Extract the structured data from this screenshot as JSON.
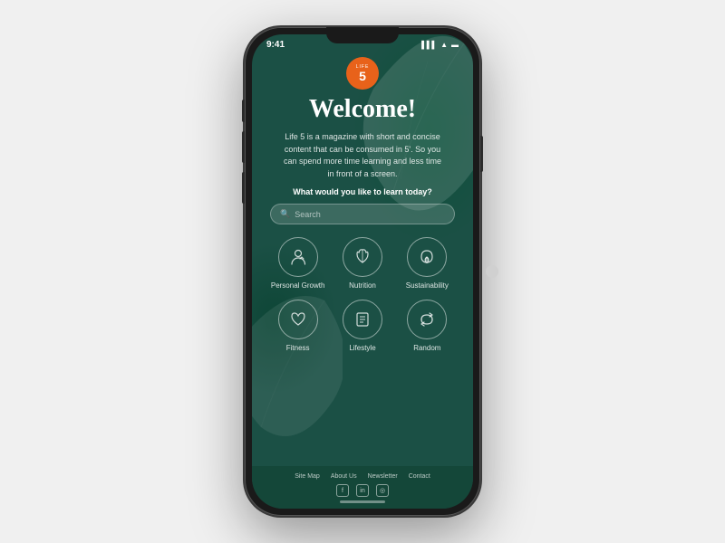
{
  "app": {
    "name": "Life 5",
    "logo_number": "5",
    "logo_sub": "LIFE"
  },
  "status_bar": {
    "time": "9:41",
    "signal": "▌▌▌",
    "wifi": "WiFi",
    "battery": "🔋"
  },
  "welcome": {
    "title": "Welcome!",
    "description": "Life 5 is a magazine with short and concise content that can be consumed in 5'. So you can spend more time learning and less time in front of a screen.",
    "question": "What would you like to learn today?"
  },
  "search": {
    "placeholder": "Search"
  },
  "categories": [
    {
      "label": "Personal Growth",
      "icon": "👤",
      "unicode": "♟"
    },
    {
      "label": "Nutrition",
      "icon": "🍎",
      "unicode": "⊕"
    },
    {
      "label": "Sustainability",
      "icon": "🌿",
      "unicode": "✿"
    },
    {
      "label": "Fitness",
      "icon": "❤",
      "unicode": "♡"
    },
    {
      "label": "Lifestyle",
      "icon": "📋",
      "unicode": "▣"
    },
    {
      "label": "Random",
      "icon": "🔄",
      "unicode": "↻"
    }
  ],
  "footer": {
    "links": [
      "Site Map",
      "About Us",
      "Newsletter",
      "Contact"
    ],
    "social": [
      "f",
      "in",
      "◎"
    ]
  }
}
